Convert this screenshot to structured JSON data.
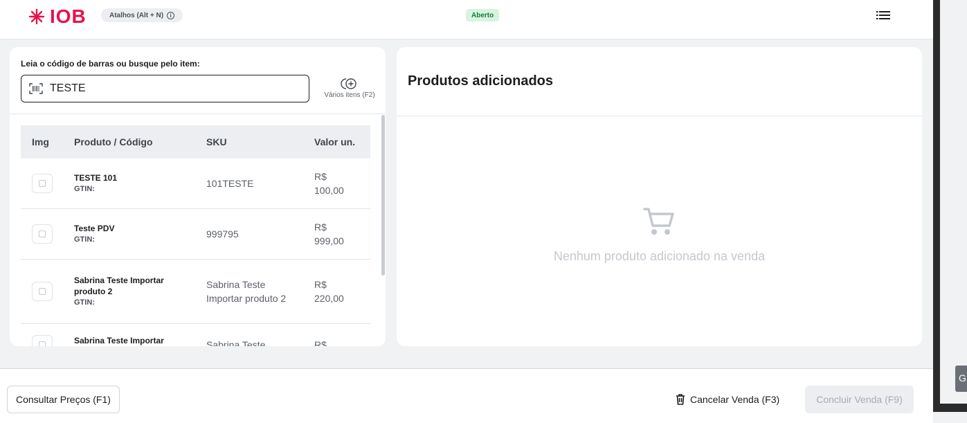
{
  "header": {
    "logo_text": "IOB",
    "shortcuts_label": "Atalhos (Alt + N)",
    "status": "Aberto",
    "icons": {
      "logo": "sparkle-icon",
      "info": "info-icon",
      "menu": "list-menu-icon"
    }
  },
  "search": {
    "label": "Leia o código de barras ou busque pelo item:",
    "value": "TESTE",
    "multi_items_label": "Vários itens (F2)"
  },
  "table": {
    "headers": {
      "img": "Img",
      "product": "Produto / Código",
      "sku": "SKU",
      "value": "Valor un."
    },
    "rows": [
      {
        "name": "TESTE 101",
        "gtin": "GTIN:",
        "sku": "101TESTE",
        "value_line1": "R$",
        "value_line2": "100,00"
      },
      {
        "name": "Teste PDV",
        "gtin": "GTIN:",
        "sku": "999795",
        "value_line1": "R$",
        "value_line2": "999,00"
      },
      {
        "name": "Sabrina Teste Importar produto 2",
        "gtin": "GTIN:",
        "sku": "Sabrina Teste Importar produto 2",
        "value_line1": "R$",
        "value_line2": "220,00"
      },
      {
        "name": "Sabrina Teste Importar",
        "gtin": "",
        "sku": "Sabrina Teste",
        "value_line1": "R$",
        "value_line2": ""
      }
    ]
  },
  "cart": {
    "title": "Produtos adicionados",
    "empty_text": "Nenhum produto adicionado na venda"
  },
  "footer": {
    "prices_button": "Consultar Preços (F1)",
    "cancel_button": "Cancelar Venda (F3)",
    "finish_button": "Concluir Venda (F9)"
  },
  "side": {
    "button_label": "G"
  },
  "colors": {
    "brand": "#e8114b",
    "status_bg": "#d6f5df",
    "status_text": "#177a3c"
  }
}
